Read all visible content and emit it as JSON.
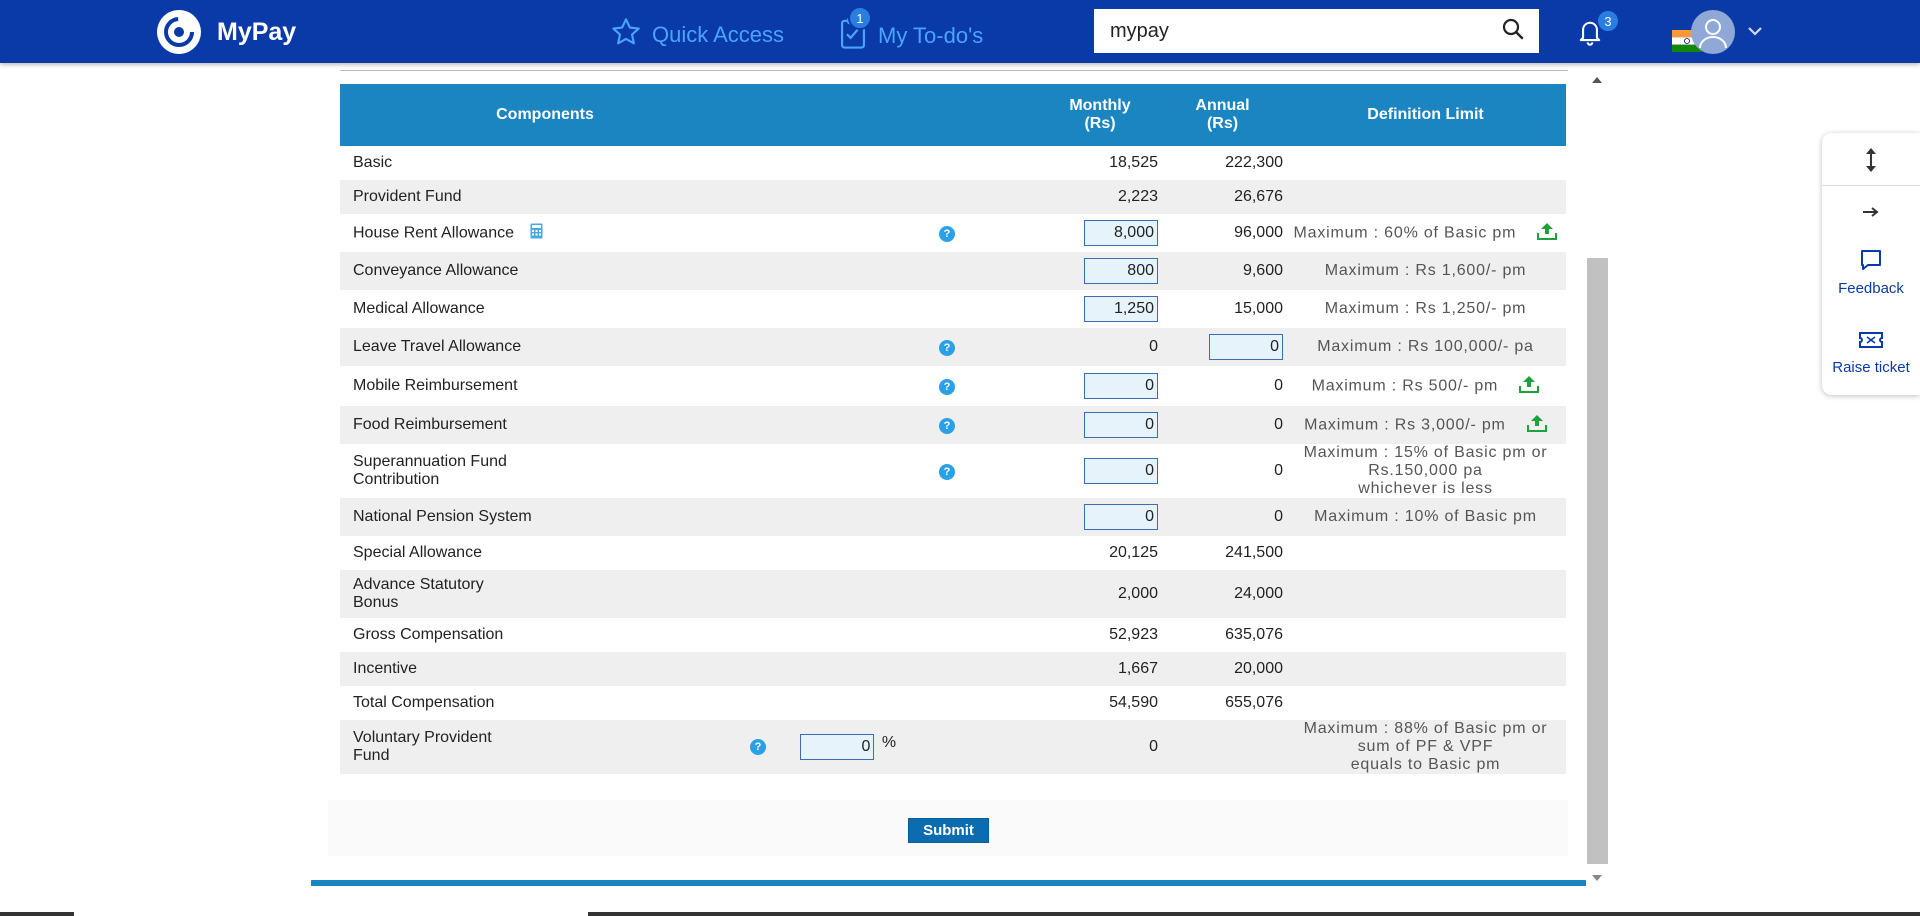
{
  "header": {
    "app_name": "MyPay",
    "quick_access": "Quick Access",
    "todos": "My To-do's",
    "todo_count": "1",
    "search_value": "mypay",
    "notification_count": "3"
  },
  "side_panel": {
    "feedback": "Feedback",
    "raise_ticket": "Raise ticket"
  },
  "table": {
    "headers": {
      "components": "Components",
      "monthly": "Monthly",
      "monthly_unit": "(Rs)",
      "annual": "Annual",
      "annual_unit": "(Rs)",
      "definition": "Definition Limit"
    },
    "rows": [
      {
        "name": "Basic",
        "monthly": "18,525",
        "annual": "222,300",
        "definition": ""
      },
      {
        "name": "Provident Fund",
        "monthly": "2,223",
        "annual": "26,676",
        "definition": ""
      },
      {
        "name": "House Rent Allowance",
        "monthly": "8,000",
        "annual": "96,000",
        "definition": "Maximum : 60% of Basic pm"
      },
      {
        "name": "Conveyance Allowance",
        "monthly": "800",
        "annual": "9,600",
        "definition": "Maximum : Rs 1,600/- pm"
      },
      {
        "name": "Medical Allowance",
        "monthly": "1,250",
        "annual": "15,000",
        "definition": "Maximum : Rs 1,250/- pm"
      },
      {
        "name": "Leave Travel Allowance",
        "monthly": "0",
        "annual": "0",
        "definition": "Maximum : Rs 100,000/- pa"
      },
      {
        "name": "Mobile Reimbursement",
        "monthly": "0",
        "annual": "0",
        "definition": "Maximum : Rs 500/- pm"
      },
      {
        "name": "Food Reimbursement",
        "monthly": "0",
        "annual": "0",
        "definition": "Maximum : Rs 3,000/- pm"
      },
      {
        "name_line1": "Superannuation Fund",
        "name_line2": "Contribution",
        "monthly": "0",
        "annual": "0",
        "definition_line1": "Maximum : 15% of Basic pm or Rs.150,000 pa",
        "definition_line2": "whichever is less"
      },
      {
        "name": "National Pension System",
        "monthly": "0",
        "annual": "0",
        "definition": "Maximum : 10% of Basic pm"
      },
      {
        "name": "Special Allowance",
        "monthly": "20,125",
        "annual": "241,500",
        "definition": ""
      },
      {
        "name_line1": "Advance Statutory",
        "name_line2": "Bonus",
        "monthly": "2,000",
        "annual": "24,000",
        "definition": ""
      },
      {
        "name": "Gross Compensation",
        "monthly": "52,923",
        "annual": "635,076",
        "definition": ""
      },
      {
        "name": "Incentive",
        "monthly": "1,667",
        "annual": "20,000",
        "definition": ""
      },
      {
        "name": "Total Compensation",
        "monthly": "54,590",
        "annual": "655,076",
        "definition": ""
      },
      {
        "name_line1": "Voluntary Provident",
        "name_line2": "Fund",
        "percent_value": "0",
        "percent_sign": "%",
        "monthly": "0",
        "definition_line1": "Maximum : 88% of Basic pm or sum of PF & VPF",
        "definition_line2": "equals to Basic pm"
      }
    ]
  },
  "submit_label": "Submit",
  "colors": {
    "header_bg": "#0a3aa8",
    "table_header": "#1a85c0",
    "input_bg": "#e6f3fb",
    "upload_icon": "#1aa33a"
  }
}
